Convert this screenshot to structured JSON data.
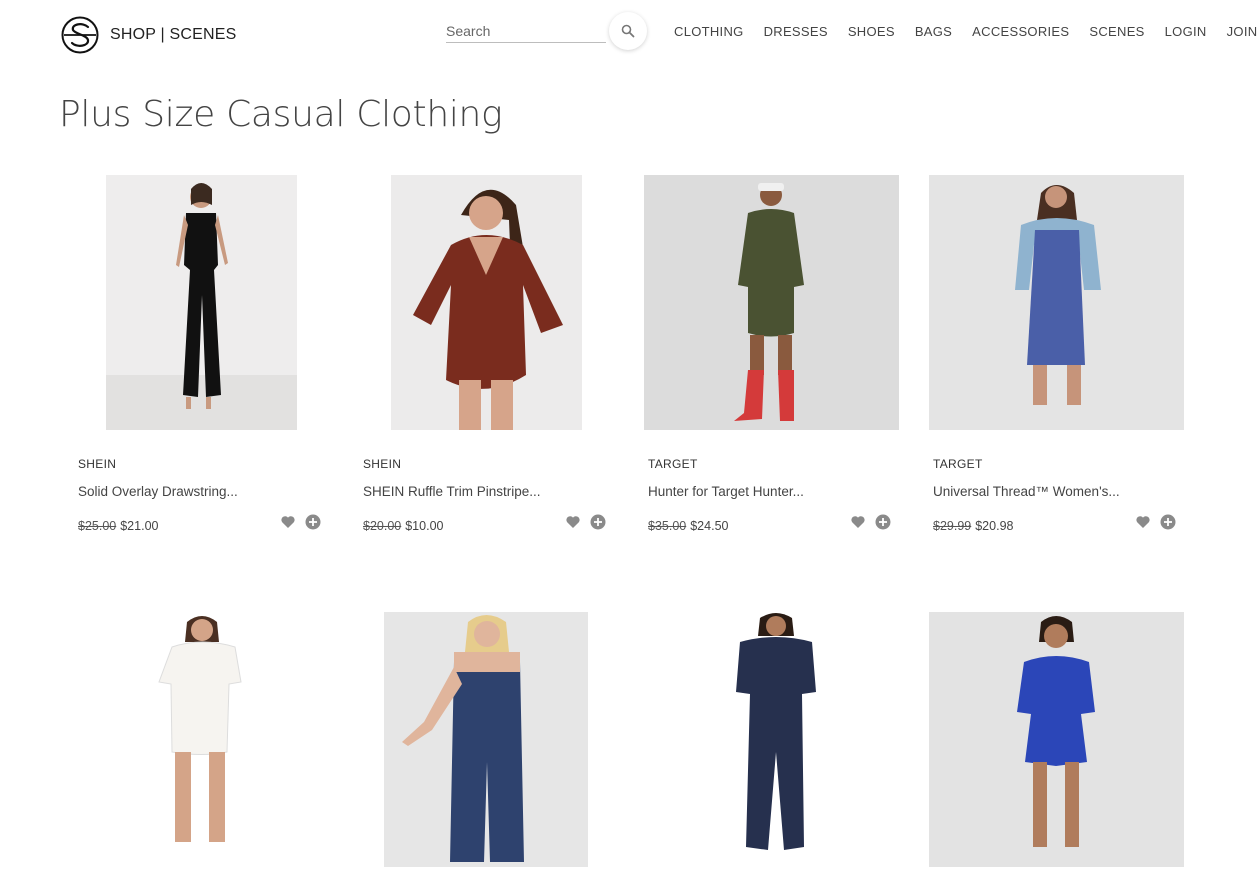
{
  "header": {
    "logo_text": "SHOP | SCENES",
    "search_placeholder": "Search",
    "nav": [
      "CLOTHING",
      "DRESSES",
      "SHOES",
      "BAGS",
      "ACCESSORIES",
      "SCENES",
      "LOGIN",
      "JOIN"
    ]
  },
  "page_title": "Plus Size Casual Clothing",
  "products": [
    {
      "brand": "SHEIN",
      "name": "Solid Overlay Drawstring...",
      "old_price": "$25.00",
      "price": "$21.00"
    },
    {
      "brand": "SHEIN",
      "name": "SHEIN Ruffle Trim Pinstripe...",
      "old_price": "$20.00",
      "price": "$10.00"
    },
    {
      "brand": "TARGET",
      "name": "Hunter for Target Hunter...",
      "old_price": "$35.00",
      "price": "$24.50"
    },
    {
      "brand": "TARGET",
      "name": "Universal Thread™ Women's...",
      "old_price": "$29.99",
      "price": "$20.98"
    }
  ],
  "colors": {
    "accent_icon": "#8a8a8a"
  }
}
